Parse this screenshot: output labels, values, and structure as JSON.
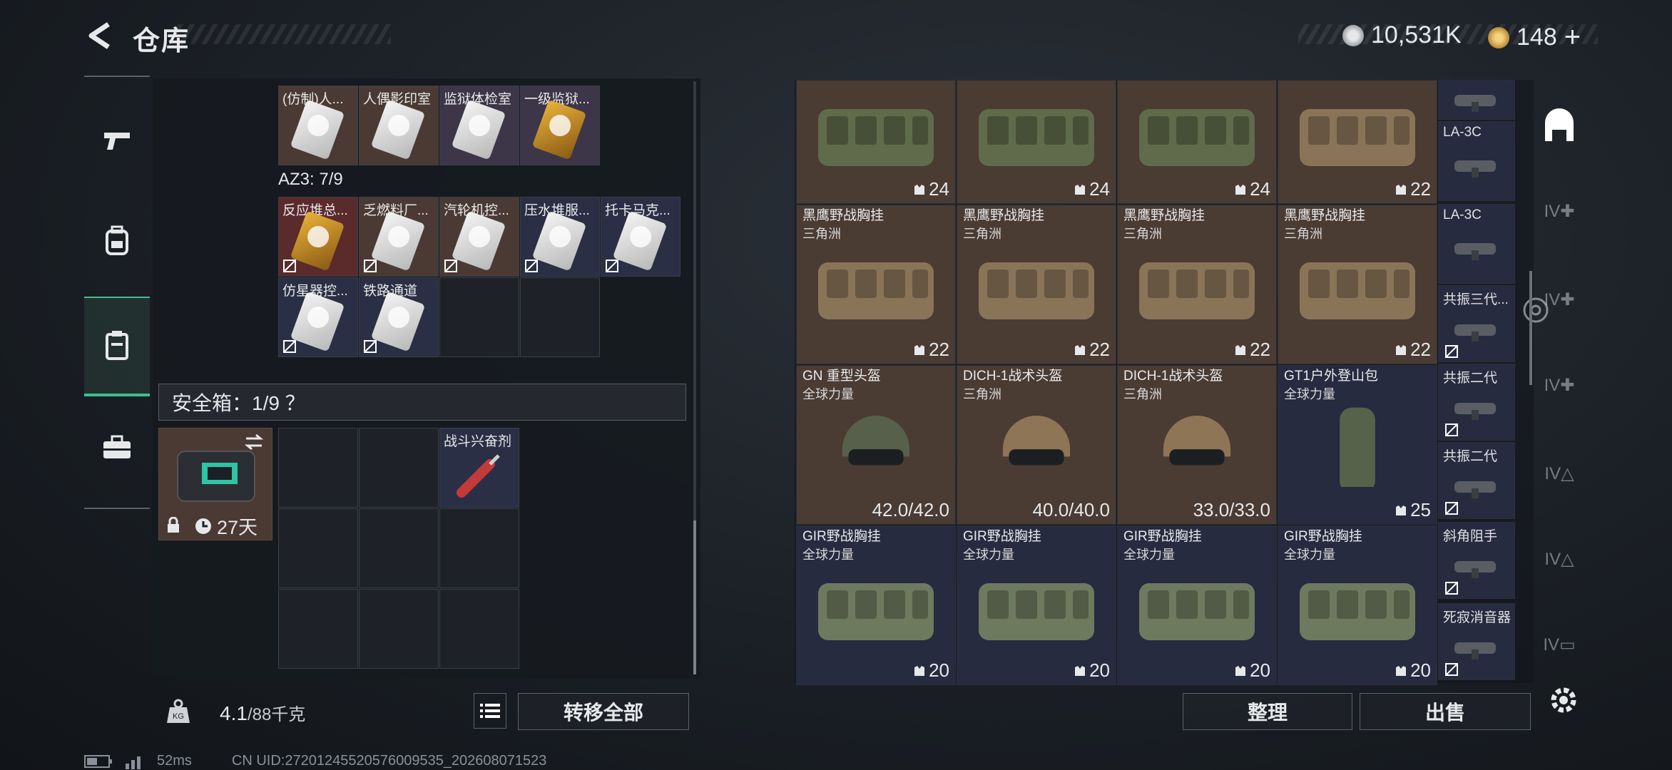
{
  "header": {
    "title": "仓库",
    "currency1": "10,531K",
    "currency2": "148",
    "currency2_plus": "+"
  },
  "colors": {
    "accent": "#3fbf8f",
    "brown_cell": "#4a3b33",
    "navy_cell": "#262b40",
    "purple_cell": "#3c3648",
    "red_cell": "#5b2a2b"
  },
  "left_nav": [
    "pistol-icon",
    "backpack-icon",
    "container-icon",
    "briefcase-icon"
  ],
  "keycards_top": [
    "(仿制)人...",
    "人偶影印室",
    "监狱体检室",
    "一级监狱..."
  ],
  "az3_label": "AZ3: 7/9",
  "keycards_az3_row1": [
    "反应堆总...",
    "乏燃料厂...",
    "汽轮机控...",
    "压水堆服...",
    "托卡马克..."
  ],
  "keycards_az3_row2": [
    "仿星器控...",
    "铁路通道"
  ],
  "safe": {
    "label": "安全箱：1/9 ？",
    "days": "27天",
    "stim_name": "战斗兴奋剂"
  },
  "weight": {
    "current": "4.1",
    "max": "/88千克"
  },
  "buttons": {
    "transfer_all": "转移全部",
    "sort": "整理",
    "sell": "出售"
  },
  "grid_rows": [
    [
      {
        "name": "",
        "sub": "",
        "count": "24",
        "color": "brown",
        "bag": "green"
      },
      {
        "name": "",
        "sub": "",
        "count": "24",
        "color": "brown",
        "bag": "green"
      },
      {
        "name": "",
        "sub": "",
        "count": "24",
        "color": "brown",
        "bag": "green"
      },
      {
        "name": "",
        "sub": "",
        "count": "22",
        "color": "brown",
        "bag": "tan"
      }
    ],
    [
      {
        "name": "黑鹰野战胸挂",
        "sub": "三角洲",
        "count": "22",
        "color": "brown",
        "bag": "tan"
      },
      {
        "name": "黑鹰野战胸挂",
        "sub": "三角洲",
        "count": "22",
        "color": "brown",
        "bag": "tan"
      },
      {
        "name": "黑鹰野战胸挂",
        "sub": "三角洲",
        "count": "22",
        "color": "brown",
        "bag": "tan"
      },
      {
        "name": "黑鹰野战胸挂",
        "sub": "三角洲",
        "count": "22",
        "color": "brown",
        "bag": "tan"
      }
    ],
    [
      {
        "name": "GN 重型头盔",
        "sub": "全球力量",
        "count": "42.0/42.0",
        "color": "brown",
        "bag": "helmet-green"
      },
      {
        "name": "DICH-1战术头盔",
        "sub": "三角洲",
        "count": "40.0/40.0",
        "color": "brown",
        "bag": "helmet-tan"
      },
      {
        "name": "DICH-1战术头盔",
        "sub": "三角洲",
        "count": "33.0/33.0",
        "color": "brown",
        "bag": "helmet-tan"
      },
      {
        "name": "GT1户外登山包",
        "sub": "全球力量",
        "count": "25",
        "color": "navy",
        "bag": "pack"
      }
    ],
    [
      {
        "name": "GIR野战胸挂",
        "sub": "全球力量",
        "count": "20",
        "color": "navy",
        "bag": "green2"
      },
      {
        "name": "GIR野战胸挂",
        "sub": "全球力量",
        "count": "20",
        "color": "navy",
        "bag": "green2"
      },
      {
        "name": "GIR野战胸挂",
        "sub": "全球力量",
        "count": "20",
        "color": "navy",
        "bag": "green2"
      },
      {
        "name": "GIR野战胸挂",
        "sub": "全球力量",
        "count": "20",
        "color": "navy",
        "bag": "green2"
      }
    ]
  ],
  "side_items": [
    "",
    "LA-3C",
    "LA-3C",
    "共振三代...",
    "共振二代",
    "共振二代",
    "斜角阻手",
    "死寂消音器"
  ],
  "footer": {
    "ping": "52ms",
    "uid": "CN UID:27201245520576009535_202608071523"
  }
}
